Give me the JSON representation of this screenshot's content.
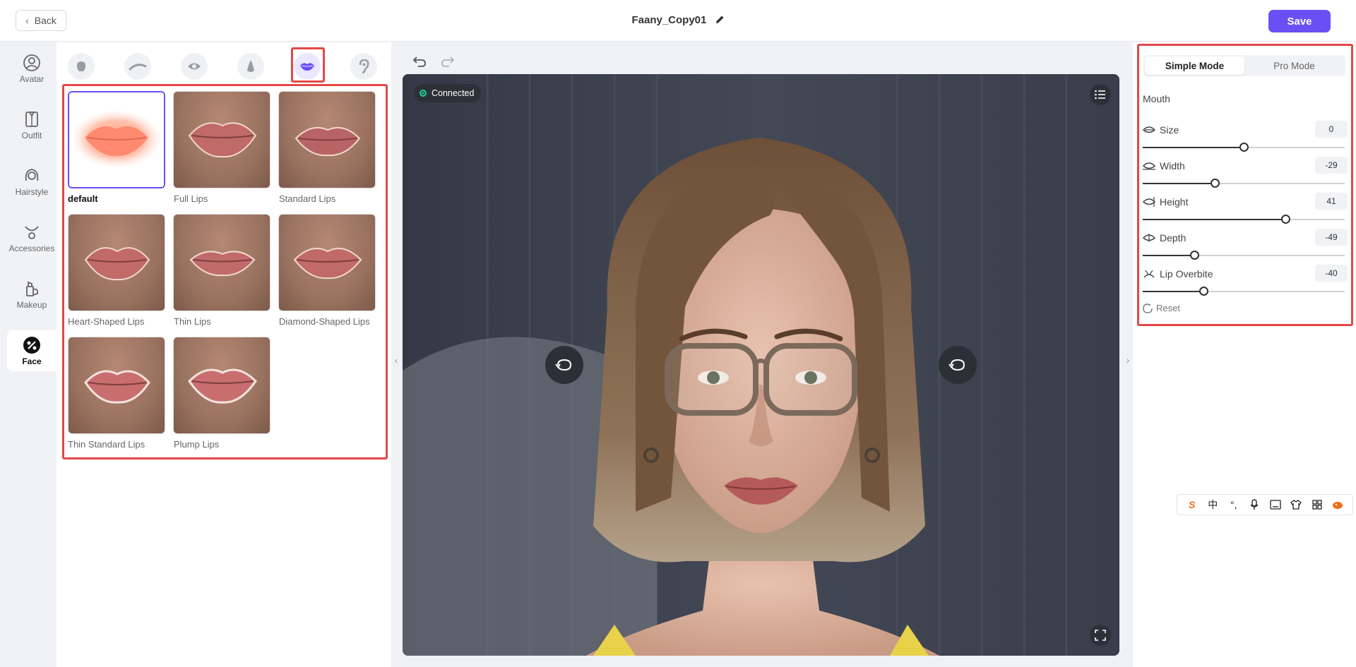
{
  "header": {
    "back_label": "Back",
    "title": "Faany_Copy01",
    "save_label": "Save"
  },
  "colors": {
    "accent": "#6a4ff5",
    "highlight_red": "#e34848",
    "connected_green": "#23d18b"
  },
  "leftnav": {
    "items": [
      {
        "label": "Avatar",
        "icon": "avatar-icon"
      },
      {
        "label": "Outfit",
        "icon": "outfit-icon"
      },
      {
        "label": "Hairstyle",
        "icon": "hairstyle-icon"
      },
      {
        "label": "Accessories",
        "icon": "accessories-icon"
      },
      {
        "label": "Makeup",
        "icon": "makeup-icon"
      },
      {
        "label": "Face",
        "icon": "face-icon",
        "active": true
      }
    ]
  },
  "categories": [
    {
      "icon": "face-shape-icon"
    },
    {
      "icon": "eyebrow-icon"
    },
    {
      "icon": "eye-icon"
    },
    {
      "icon": "nose-icon"
    },
    {
      "icon": "lips-icon",
      "active": true
    },
    {
      "icon": "ear-icon"
    }
  ],
  "presets": [
    {
      "label": "default",
      "selected": true
    },
    {
      "label": "Full Lips"
    },
    {
      "label": "Standard Lips"
    },
    {
      "label": "Heart-Shaped Lips"
    },
    {
      "label": "Thin Lips"
    },
    {
      "label": "Diamond-Shaped Lips"
    },
    {
      "label": "Thin Standard Lips"
    },
    {
      "label": "Plump Lips"
    }
  ],
  "viewer": {
    "status": "Connected"
  },
  "panel": {
    "modes": [
      "Simple Mode",
      "Pro Mode"
    ],
    "active_mode": "Simple Mode",
    "section": "Mouth",
    "sliders": [
      {
        "label": "Size",
        "value": "0",
        "fraction": 0.5
      },
      {
        "label": "Width",
        "value": "-29",
        "fraction": 0.355
      },
      {
        "label": "Height",
        "value": "41",
        "fraction": 0.705
      },
      {
        "label": "Depth",
        "value": "-49",
        "fraction": 0.255
      },
      {
        "label": "Lip Overbite",
        "value": "-40",
        "fraction": 0.3
      }
    ],
    "reset_label": "Reset"
  },
  "ime": {
    "items": [
      "S",
      "中",
      "°,",
      "mic",
      "keyboard",
      "shirt",
      "grid",
      "fox"
    ]
  }
}
